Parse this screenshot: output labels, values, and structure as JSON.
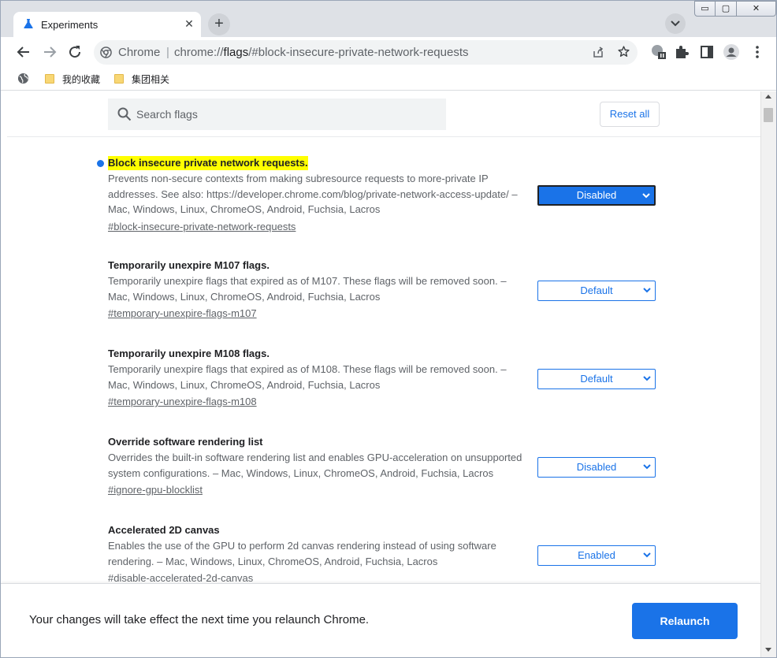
{
  "tab": {
    "title": "Experiments",
    "close_glyph": "✕"
  },
  "newtab_glyph": "+",
  "window_controls": {
    "minimize": "▭",
    "maximize": "▢",
    "close": "✕"
  },
  "omnibox": {
    "site_label": "Chrome",
    "separator": "|",
    "url_scheme": "chrome://",
    "url_host": "flags",
    "url_path": "/#block-insecure-private-network-requests"
  },
  "bookmarks": [
    {
      "label": "我的收藏"
    },
    {
      "label": "集团相关"
    }
  ],
  "search": {
    "placeholder": "Search flags"
  },
  "reset_label": "Reset all",
  "flags": [
    {
      "title": "Block insecure private network requests.",
      "description": "Prevents non-secure contexts from making subresource requests to more-private IP addresses. See also: https://developer.chrome.com/blog/private-network-access-update/ – Mac, Windows, Linux, ChromeOS, Android, Fuchsia, Lacros",
      "link": "#block-insecure-private-network-requests",
      "value": "Disabled"
    },
    {
      "title": "Temporarily unexpire M107 flags.",
      "description": "Temporarily unexpire flags that expired as of M107. These flags will be removed soon. – Mac, Windows, Linux, ChromeOS, Android, Fuchsia, Lacros",
      "link": "#temporary-unexpire-flags-m107",
      "value": "Default"
    },
    {
      "title": "Temporarily unexpire M108 flags.",
      "description": "Temporarily unexpire flags that expired as of M108. These flags will be removed soon. – Mac, Windows, Linux, ChromeOS, Android, Fuchsia, Lacros",
      "link": "#temporary-unexpire-flags-m108",
      "value": "Default"
    },
    {
      "title": "Override software rendering list",
      "description": "Overrides the built-in software rendering list and enables GPU-acceleration on unsupported system configurations. – Mac, Windows, Linux, ChromeOS, Android, Fuchsia, Lacros",
      "link": "#ignore-gpu-blocklist",
      "value": "Disabled"
    },
    {
      "title": "Accelerated 2D canvas",
      "description": "Enables the use of the GPU to perform 2d canvas rendering instead of using software rendering. – Mac, Windows, Linux, ChromeOS, Android, Fuchsia, Lacros",
      "link": "#disable-accelerated-2d-canvas",
      "value": "Enabled"
    }
  ],
  "footer": {
    "message": "Your changes will take effect the next time you relaunch Chrome.",
    "relaunch_label": "Relaunch"
  },
  "colors": {
    "accent": "#1a73e8",
    "highlight": "#ffff00",
    "tabstrip": "#dee1e6"
  }
}
